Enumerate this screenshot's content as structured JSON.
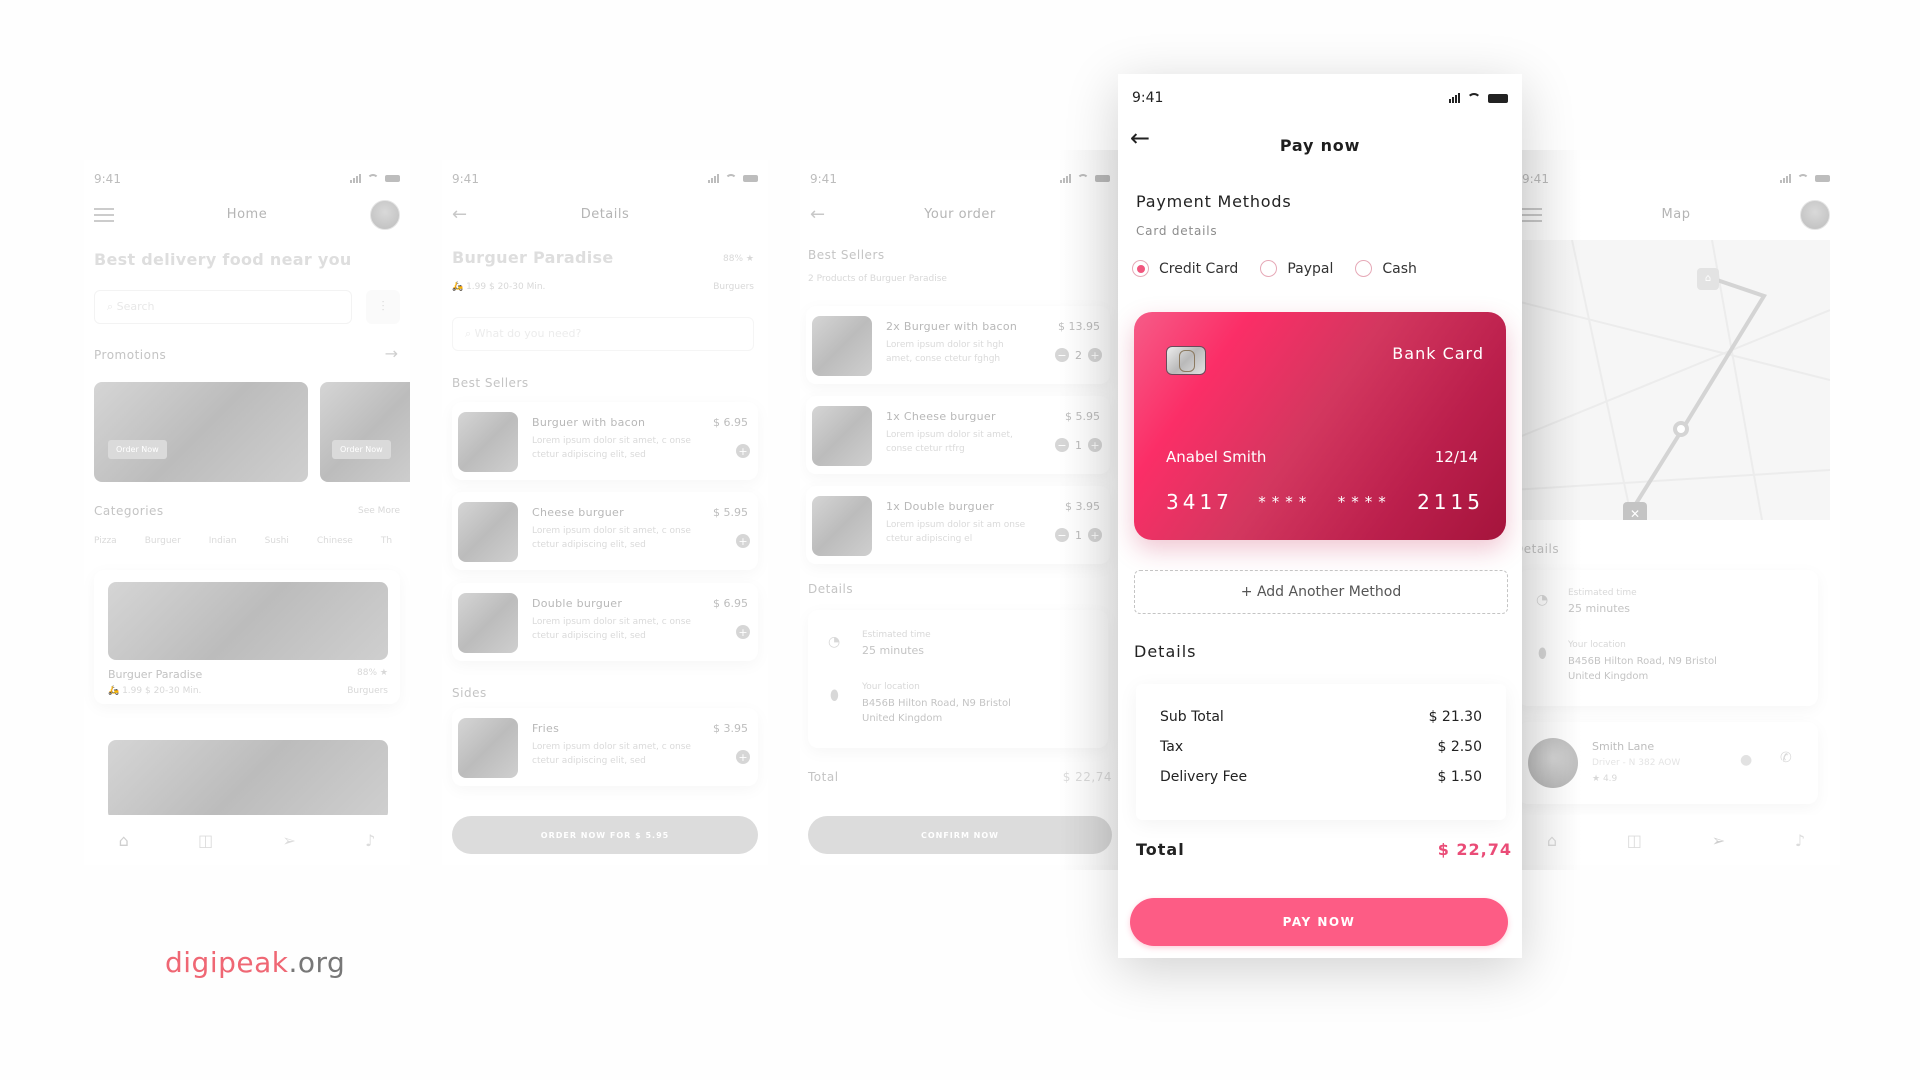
{
  "status_time": "9:41",
  "home": {
    "title": "Home",
    "headline": "Best delivery food near you",
    "search_placeholder": "Search",
    "promotions_label": "Promotions",
    "promo_buttons": [
      "Order Now",
      "Order Now"
    ],
    "categories_label": "Categories",
    "see_more": "See More",
    "categories": [
      "Pizza",
      "Burguer",
      "Indian",
      "Sushi",
      "Chinese",
      "Th"
    ],
    "restaurant": {
      "name": "Burguer Paradise",
      "rating": "88%",
      "meta": "1.99 $ 20-30 Min.",
      "type": "Burguers"
    }
  },
  "details": {
    "title": "Details",
    "restaurant": "Burguer Paradise",
    "rating": "88%",
    "meta": "1.99 $ 20-30 Min.",
    "type": "Burguers",
    "search_placeholder": "What do you need?",
    "best_sellers_label": "Best Sellers",
    "items": [
      {
        "name": "Burguer with bacon",
        "price": "$ 6.95",
        "desc": "Lorem ipsum dolor sit amet, c onse ctetur adipiscing elit, sed"
      },
      {
        "name": "Cheese burguer",
        "price": "$ 5.95",
        "desc": "Lorem ipsum dolor sit amet, c onse ctetur adipiscing elit, sed"
      },
      {
        "name": "Double burguer",
        "price": "$ 6.95",
        "desc": "Lorem ipsum dolor sit amet, c onse ctetur adipiscing elit, sed"
      }
    ],
    "sides_label": "Sides",
    "sides": [
      {
        "name": "Fries",
        "price": "$ 3.95",
        "desc": "Lorem ipsum dolor sit amet, c onse ctetur adipiscing elit, sed"
      }
    ],
    "order_button": "ORDER NOW FOR $ 5.95"
  },
  "order": {
    "title": "Your order",
    "section": "Best Sellers",
    "subtitle": "2 Products of Burguer Paradise",
    "items": [
      {
        "name": "2x Burguer with bacon",
        "price": "$ 13.95",
        "qty": "2",
        "desc": "Lorem ipsum dolor sit hgh amet, conse ctetur fghgh"
      },
      {
        "name": "1x Cheese burguer",
        "price": "$ 5.95",
        "qty": "1",
        "desc": "Lorem ipsum dolor sit amet, conse ctetur rtfrg"
      },
      {
        "name": "1x Double burguer",
        "price": "$ 3.95",
        "qty": "1",
        "desc": "Lorem ipsum dolor sit am onse ctetur adipiscing el"
      }
    ],
    "details_label": "Details",
    "est_label": "Estimated time",
    "est_value": "25 minutes",
    "loc_label": "Your location",
    "loc_line1": "B456B Hilton Road, N9 Bristol",
    "loc_line2": "United Kingdom",
    "total_label": "Total",
    "total_value": "$ 22,74",
    "confirm_button": "CONFIRM NOW"
  },
  "pay": {
    "title": "Pay now",
    "section": "Payment Methods",
    "subtitle": "Card details",
    "methods": [
      {
        "label": "Credit Card",
        "selected": true
      },
      {
        "label": "Paypal",
        "selected": false
      },
      {
        "label": "Cash",
        "selected": false
      }
    ],
    "card": {
      "type": "Bank Card",
      "holder": "Anabel Smith",
      "expiry": "12/14",
      "num_first": "3417",
      "num_mask1": "****",
      "num_mask2": "****",
      "num_last": "2115"
    },
    "add_method": "+ Add Another Method",
    "details_label": "Details",
    "rows": [
      {
        "label": "Sub Total",
        "value": "$ 21.30"
      },
      {
        "label": "Tax",
        "value": "$ 2.50"
      },
      {
        "label": "Delivery Fee",
        "value": "$ 1.50"
      }
    ],
    "total_label": "Total",
    "total_value": "$ 22,74",
    "pay_button": "PAY NOW",
    "accent": "#fd5c85"
  },
  "map": {
    "title": "Map",
    "details_label": "Details",
    "est_label": "Estimated time",
    "est_value": "25 minutes",
    "loc_label": "Your location",
    "loc_line1": "B456B Hilton Road, N9 Bristol",
    "loc_line2": "United Kingdom",
    "driver": {
      "name": "Smith Lane",
      "info": "Driver - N 382 AOW",
      "rating": "4.9"
    }
  },
  "brand": {
    "name": "digipeak",
    "tld": ".org"
  }
}
